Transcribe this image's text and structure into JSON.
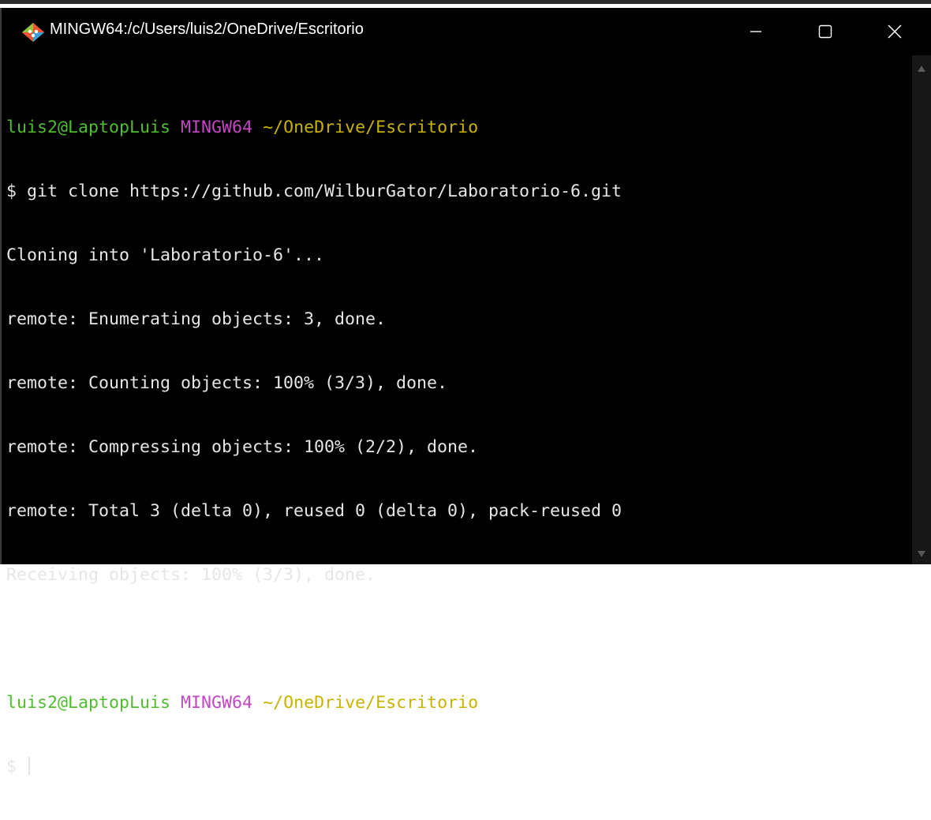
{
  "window": {
    "title": "MINGW64:/c/Users/luis2/OneDrive/Escritorio",
    "icon": "git-diamond-icon",
    "controls": [
      "minimize-icon",
      "maximize-icon",
      "close-icon"
    ]
  },
  "terminal": {
    "colors": {
      "background": "#000000",
      "text": "#e6e6e6",
      "user_host": "#4fbe2e",
      "system": "#c347c3",
      "path": "#c8b400"
    },
    "prompt1": {
      "user_host": "luis2@LaptopLuis",
      "system": "MINGW64",
      "path": "~/OneDrive/Escritorio"
    },
    "command": "$ git clone https://github.com/WilburGator/Laboratorio-6.git",
    "output": [
      "Cloning into 'Laboratorio-6'...",
      "remote: Enumerating objects: 3, done.",
      "remote: Counting objects: 100% (3/3), done.",
      "remote: Compressing objects: 100% (2/2), done.",
      "remote: Total 3 (delta 0), reused 0 (delta 0), pack-reused 0",
      "Receiving objects: 100% (3/3), done."
    ],
    "prompt2": {
      "user_host": "luis2@LaptopLuis",
      "system": "MINGW64",
      "path": "~/OneDrive/Escritorio"
    },
    "input_prefix": "$ ",
    "input_value": ""
  }
}
